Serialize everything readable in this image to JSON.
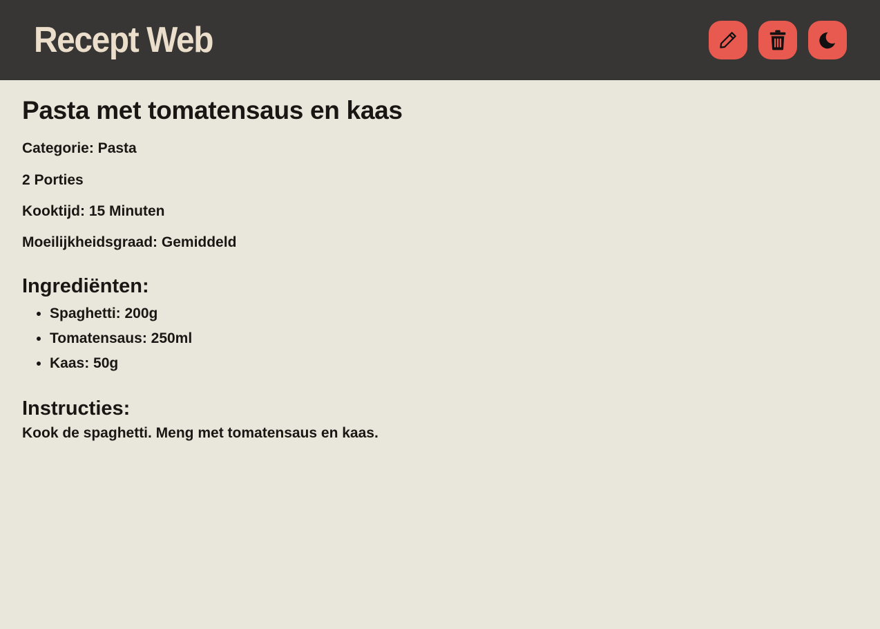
{
  "header": {
    "brand": "Recept Web",
    "buttons": {
      "edit_icon": "pencil-icon",
      "delete_icon": "trash-icon",
      "theme_icon": "moon-icon"
    },
    "button_color": "#e85a4f",
    "background": "#383634",
    "brand_color": "#ebdfcc"
  },
  "recipe": {
    "title": "Pasta met tomatensaus en kaas",
    "category": "Categorie: Pasta",
    "portions": "2 Porties",
    "cook_time": "Kooktijd: 15 Minuten",
    "difficulty": "Moeilijkheidsgraad: Gemiddeld",
    "ingredients_heading": "Ingrediënten:",
    "ingredients": [
      "Spaghetti: 200g",
      "Tomatensaus: 250ml",
      "Kaas: 50g"
    ],
    "instructions_heading": "Instructies:",
    "instructions": "Kook de spaghetti. Meng met tomatensaus en kaas."
  },
  "page_background": "#e9e6dc"
}
